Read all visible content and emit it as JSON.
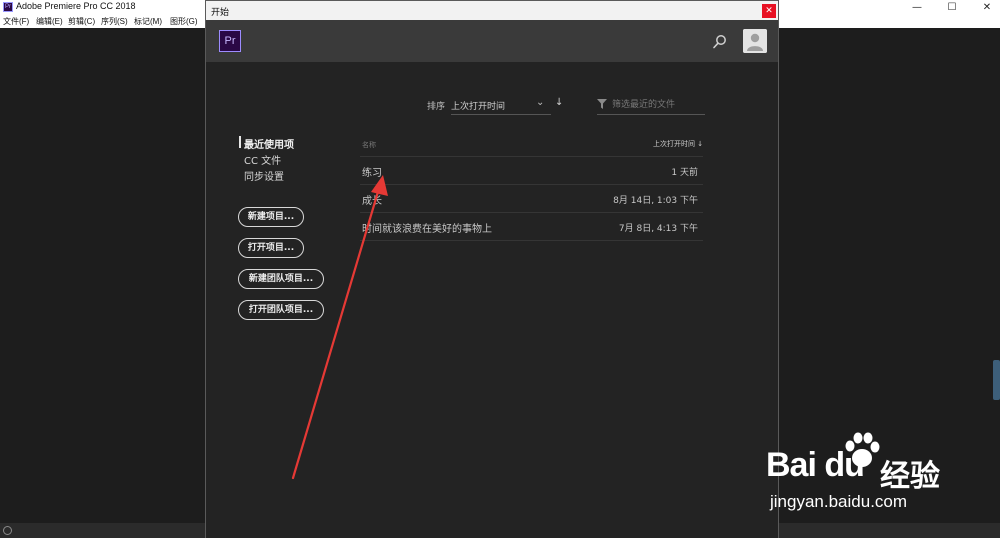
{
  "app": {
    "title": "Adobe Premiere Pro CC 2018",
    "icon_text": "Pr",
    "window_controls": {
      "minimize": "—",
      "maximize": "☐",
      "close": "✕"
    },
    "menu": [
      "文件(F)",
      "编辑(E)",
      "剪辑(C)",
      "序列(S)",
      "标记(M)",
      "图形(G)"
    ]
  },
  "dialog": {
    "title": "开始",
    "close_glyph": "✕",
    "logo": "Pr",
    "header_icons": [
      "search-icon",
      "user-avatar-icon"
    ],
    "sort": {
      "label": "排序",
      "value": "上次打开时间",
      "chevron": "⌄",
      "direction": "↓"
    },
    "filter": {
      "placeholder": "筛选最近的文件"
    },
    "nav": {
      "items": [
        "最近使用项",
        "CC 文件",
        "同步设置"
      ],
      "active_index": 0
    },
    "buttons": [
      "新建项目...",
      "打开项目...",
      "新建团队项目...",
      "打开团队项目..."
    ],
    "list": {
      "header_name": "名称",
      "header_date": "上次打开时间 ↓",
      "rows": [
        {
          "name": "练习",
          "date": "1 天前"
        },
        {
          "name": "成长",
          "date": "8月 14日, 1:03 下午"
        },
        {
          "name": "时间就该浪费在美好的事物上",
          "date": "7月 8日, 4:13 下午"
        }
      ]
    }
  },
  "annotation": {
    "color": "#e53935"
  },
  "watermark": {
    "logo": "Bai du",
    "name": "经验",
    "url": "jingyan.baidu.com"
  },
  "colors": {
    "accent_pr": "#9d8cff",
    "dialog_bg": "#232323",
    "header_bg": "#3a3a3a",
    "close_red": "#e81123"
  }
}
